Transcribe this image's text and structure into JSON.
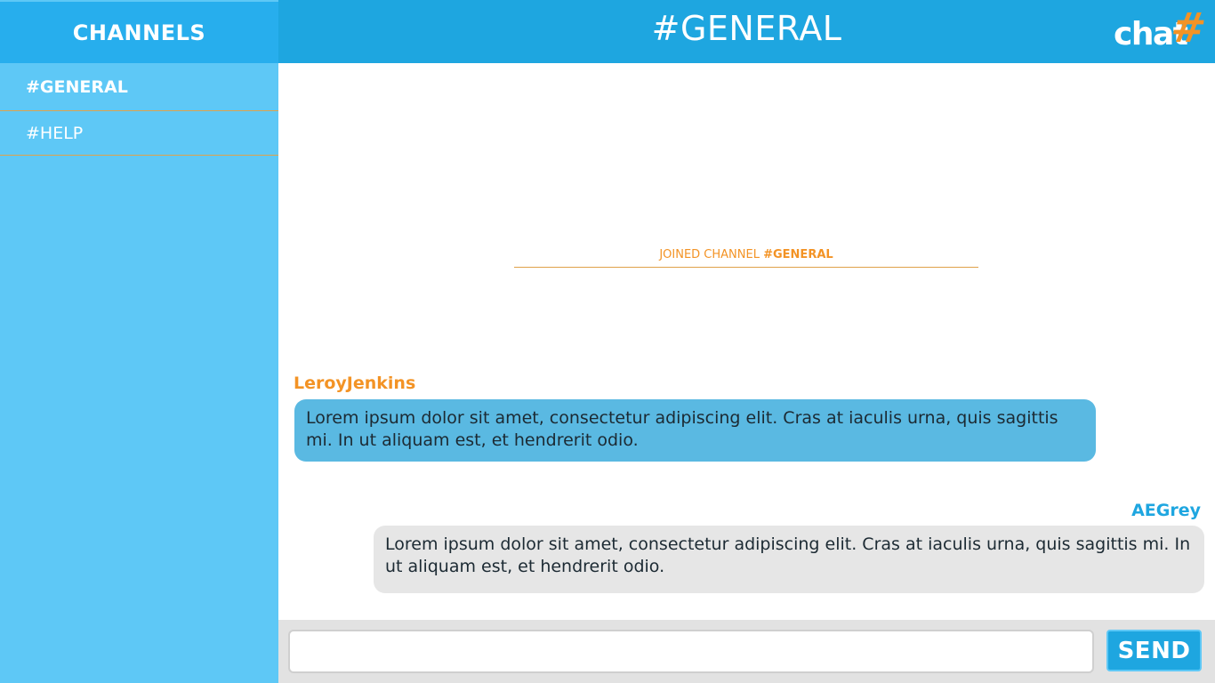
{
  "sidebar": {
    "title": "CHANNELS",
    "channels": [
      {
        "label": "#GENERAL",
        "active": true
      },
      {
        "label": "#HELP",
        "active": false
      }
    ]
  },
  "header": {
    "channel_title": "#GENERAL",
    "logo_text": "chat",
    "logo_symbol": "#"
  },
  "chat": {
    "joined_prefix": "JOINED CHANNEL",
    "joined_channel": "#GENERAL",
    "messages": [
      {
        "user": "LeroyJenkins",
        "text": "Lorem ipsum dolor sit amet, consectetur adipiscing elit. Cras at iaculis urna, quis sagittis mi. In ut aliquam est, et hendrerit odio."
      },
      {
        "user": "AEGrey",
        "text": "Lorem ipsum dolor sit amet, consectetur adipiscing elit. Cras at iaculis urna, quis sagittis mi. In ut aliquam est, et hendrerit odio."
      }
    ]
  },
  "composer": {
    "input_value": "",
    "placeholder": "",
    "send_label": "SEND"
  },
  "colors": {
    "accent_blue": "#1ea6e0",
    "sidebar_blue": "#5ec8f6",
    "accent_orange": "#f39325"
  }
}
